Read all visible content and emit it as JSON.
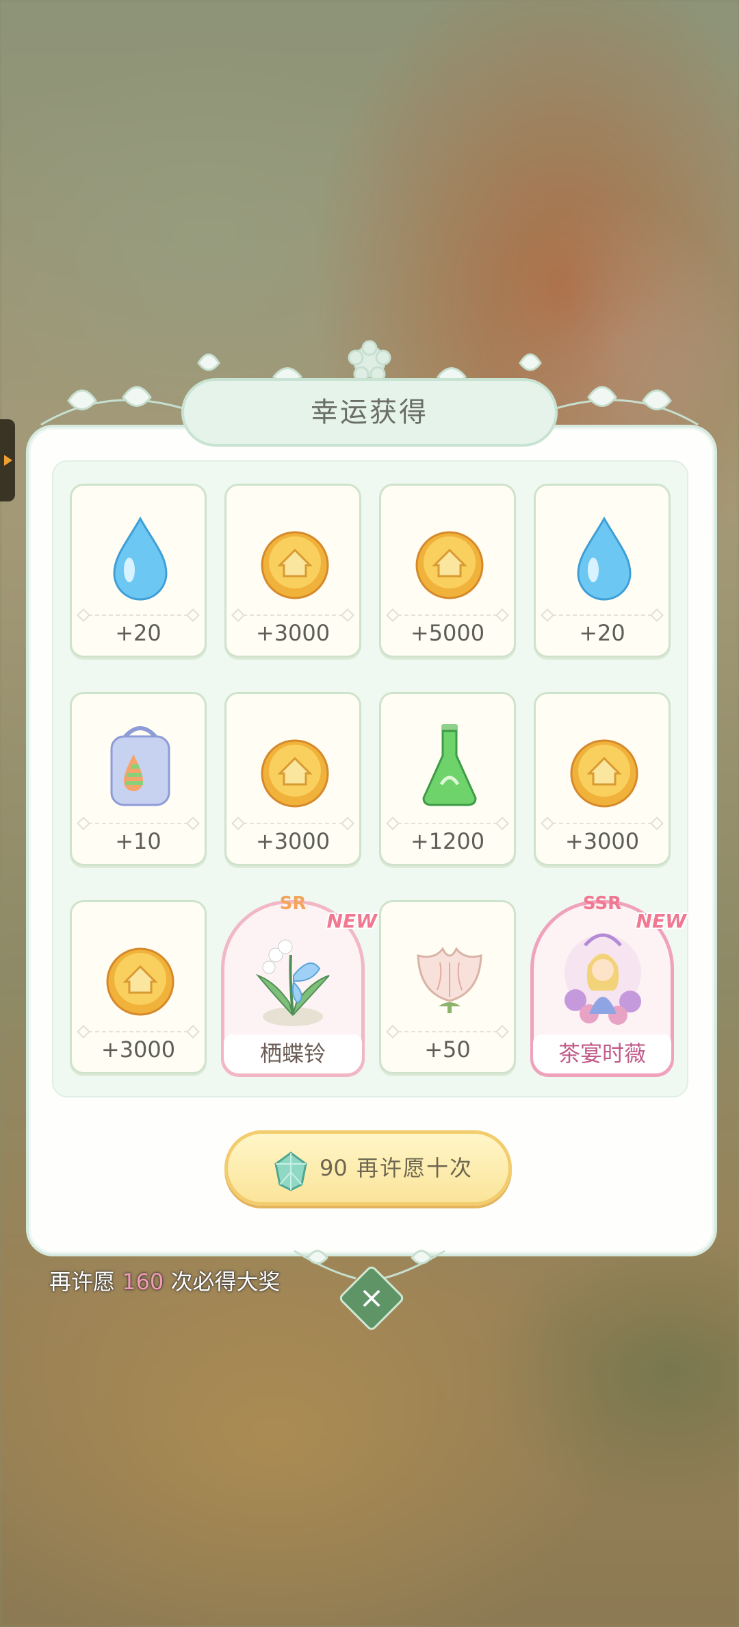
{
  "dialog": {
    "title": "幸运获得"
  },
  "rewards": [
    {
      "type": "item",
      "icon": "water-drop-icon",
      "amount": "+20"
    },
    {
      "type": "item",
      "icon": "gold-coin-icon",
      "amount": "+3000"
    },
    {
      "type": "item",
      "icon": "gold-coin-icon",
      "amount": "+5000"
    },
    {
      "type": "item",
      "icon": "water-drop-icon",
      "amount": "+20"
    },
    {
      "type": "item",
      "icon": "rainbow-bag-icon",
      "amount": "+10"
    },
    {
      "type": "item",
      "icon": "gold-coin-icon",
      "amount": "+3000"
    },
    {
      "type": "item",
      "icon": "potion-flask-icon",
      "amount": "+1200"
    },
    {
      "type": "item",
      "icon": "gold-coin-icon",
      "amount": "+3000"
    },
    {
      "type": "item",
      "icon": "gold-coin-icon",
      "amount": "+3000"
    },
    {
      "type": "card",
      "icon": "butterfly-plant-icon",
      "rarity": "SR",
      "badge": "NEW",
      "name": "栖蝶铃"
    },
    {
      "type": "item",
      "icon": "flower-bud-icon",
      "amount": "+50"
    },
    {
      "type": "card",
      "icon": "tea-party-girl-icon",
      "rarity": "SSR",
      "badge": "NEW",
      "name": "茶宴时薇"
    }
  ],
  "wish_button": {
    "cost": "90",
    "label": "再许愿十次"
  },
  "pity_note": {
    "prefix": "再许愿",
    "count": "160",
    "suffix": "次必得大奖"
  },
  "colors": {
    "rarity_sr": "#f3a55c",
    "rarity_ssr": "#f07890",
    "card_name_sr": "#6b5c55",
    "card_name_ssr": "#c05c8a"
  }
}
